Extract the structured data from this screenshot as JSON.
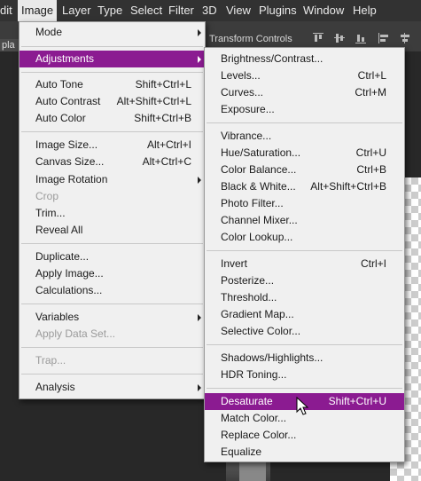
{
  "menubar": {
    "items": [
      "dit",
      "Image",
      "Layer",
      "Type",
      "Select",
      "Filter",
      "3D",
      "View",
      "Plugins",
      "Window",
      "Help"
    ]
  },
  "options_bar": {
    "transform_controls": "Transform Controls",
    "doc_tab_fragment": "pla"
  },
  "image_menu": {
    "mode": "Mode",
    "adjustments": "Adjustments",
    "auto_tone": {
      "label": "Auto Tone",
      "shortcut": "Shift+Ctrl+L"
    },
    "auto_contrast": {
      "label": "Auto Contrast",
      "shortcut": "Alt+Shift+Ctrl+L"
    },
    "auto_color": {
      "label": "Auto Color",
      "shortcut": "Shift+Ctrl+B"
    },
    "image_size": {
      "label": "Image Size...",
      "shortcut": "Alt+Ctrl+I"
    },
    "canvas_size": {
      "label": "Canvas Size...",
      "shortcut": "Alt+Ctrl+C"
    },
    "image_rotation": "Image Rotation",
    "crop": "Crop",
    "trim": "Trim...",
    "reveal_all": "Reveal All",
    "duplicate": "Duplicate...",
    "apply_image": "Apply Image...",
    "calculations": "Calculations...",
    "variables": "Variables",
    "apply_data_set": "Apply Data Set...",
    "trap": "Trap...",
    "analysis": "Analysis"
  },
  "adjustments_menu": {
    "brightness_contrast": {
      "label": "Brightness/Contrast...",
      "shortcut": ""
    },
    "levels": {
      "label": "Levels...",
      "shortcut": "Ctrl+L"
    },
    "curves": {
      "label": "Curves...",
      "shortcut": "Ctrl+M"
    },
    "exposure": {
      "label": "Exposure...",
      "shortcut": ""
    },
    "vibrance": {
      "label": "Vibrance...",
      "shortcut": ""
    },
    "hue_saturation": {
      "label": "Hue/Saturation...",
      "shortcut": "Ctrl+U"
    },
    "color_balance": {
      "label": "Color Balance...",
      "shortcut": "Ctrl+B"
    },
    "black_white": {
      "label": "Black & White...",
      "shortcut": "Alt+Shift+Ctrl+B"
    },
    "photo_filter": {
      "label": "Photo Filter...",
      "shortcut": ""
    },
    "channel_mixer": {
      "label": "Channel Mixer...",
      "shortcut": ""
    },
    "color_lookup": {
      "label": "Color Lookup...",
      "shortcut": ""
    },
    "invert": {
      "label": "Invert",
      "shortcut": "Ctrl+I"
    },
    "posterize": {
      "label": "Posterize...",
      "shortcut": ""
    },
    "threshold": {
      "label": "Threshold...",
      "shortcut": ""
    },
    "gradient_map": {
      "label": "Gradient Map...",
      "shortcut": ""
    },
    "selective_color": {
      "label": "Selective Color...",
      "shortcut": ""
    },
    "shadows_highlights": {
      "label": "Shadows/Highlights...",
      "shortcut": ""
    },
    "hdr_toning": {
      "label": "HDR Toning...",
      "shortcut": ""
    },
    "desaturate": {
      "label": "Desaturate",
      "shortcut": "Shift+Ctrl+U"
    },
    "match_color": {
      "label": "Match Color...",
      "shortcut": ""
    },
    "replace_color": {
      "label": "Replace Color...",
      "shortcut": ""
    },
    "equalize": {
      "label": "Equalize",
      "shortcut": ""
    }
  },
  "colors": {
    "highlight": "#8b1b91",
    "menu_bg": "#f0f0f0",
    "menubar_bg": "#323232"
  }
}
